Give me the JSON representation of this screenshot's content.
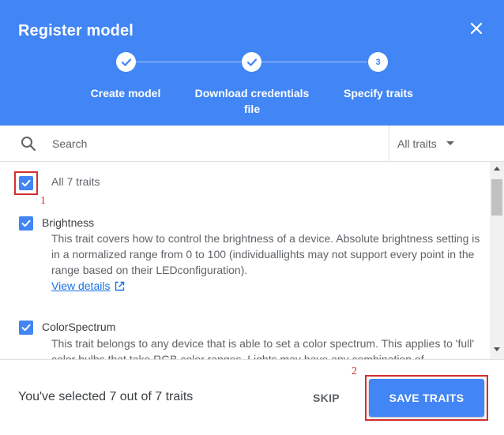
{
  "dialog": {
    "title": "Register model"
  },
  "steps": [
    {
      "label": "Create model",
      "status": "done"
    },
    {
      "label_line1": "Download credentials",
      "label_line2": "file",
      "status": "done"
    },
    {
      "label": "Specify traits",
      "number": "3",
      "status": "current"
    }
  ],
  "search": {
    "placeholder": "Search",
    "value": "",
    "filter_value": "All traits"
  },
  "list": {
    "all": {
      "label": "All 7 traits",
      "checked": true
    },
    "items": [
      {
        "title": "Brightness",
        "checked": true,
        "desc_lines": [
          "This trait covers how to control the brightness of a device. Absolute brightness setting is",
          "in a normalized range from 0 to 100 (individuallights may not support every point in the",
          "range based on their LEDconfiguration)."
        ],
        "link": "View details"
      },
      {
        "title": "ColorSpectrum",
        "checked": true,
        "desc_lines": [
          "This trait belongs to any device that is able to set a color spectrum. This applies to 'full'",
          "color bulbs that take RGB color ranges. Lights may have any combination of"
        ]
      }
    ]
  },
  "annotations": {
    "one": "1",
    "two": "2"
  },
  "footer": {
    "status_text": "You've selected 7 out of 7 traits",
    "skip_label": "SKIP",
    "save_label": "SAVE TRAITS"
  },
  "colors": {
    "header_bg": "#4285f4",
    "accent": "#4285f4",
    "link": "#1a73e8",
    "annotation": "#d32f2f"
  }
}
